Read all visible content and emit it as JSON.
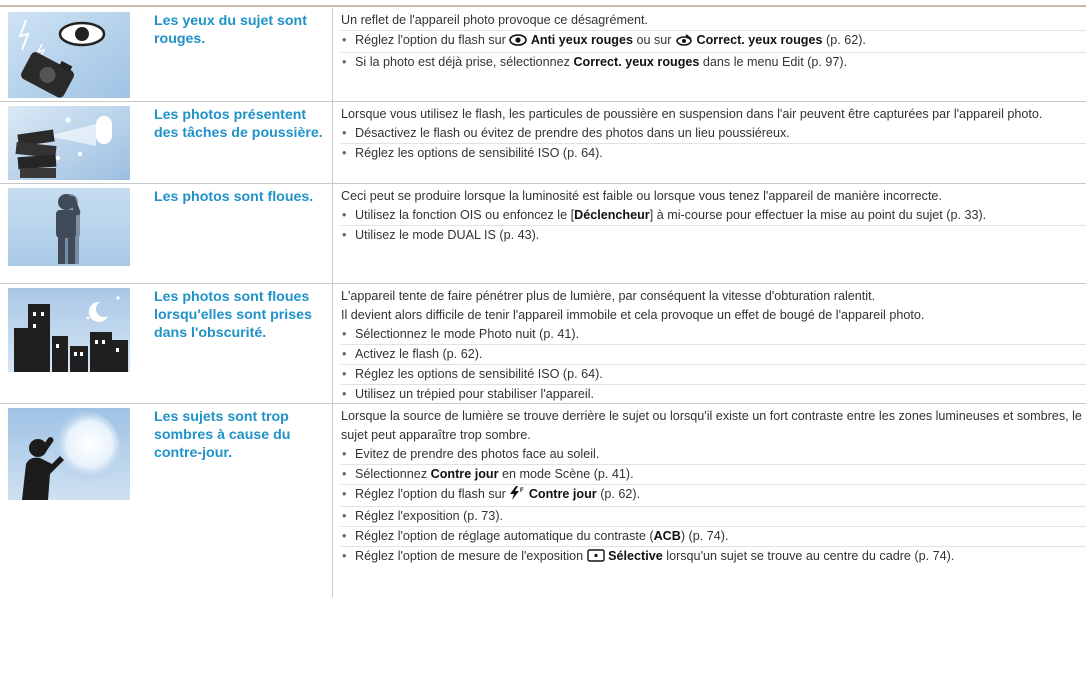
{
  "rows": [
    {
      "problem": "Les yeux du sujet sont rouges.",
      "intro": "Un reflet de l'appareil photo provoque ce désagrément.",
      "b1": {
        "pre": "Réglez l'option du flash sur",
        "k1": "Anti yeux rouges",
        "mid": "ou sur",
        "k2": "Correct. yeux rouges",
        "post": "(p. 62)."
      },
      "b2": {
        "pre": "Si la photo est déjà prise, sélectionnez",
        "k1": "Correct. yeux rouges",
        "post": "dans le menu Edit (p. 97)."
      }
    },
    {
      "problem": "Les photos présentent des tâches de poussière.",
      "intro": "Lorsque vous utilisez le flash, les particules de poussière en suspension dans l'air peuvent être capturées par l'appareil photo.",
      "b1": "Désactivez le flash ou évitez de prendre des photos dans un lieu poussiéreux.",
      "b2": "Réglez les options de sensibilité ISO (p. 64)."
    },
    {
      "problem": "Les photos sont floues.",
      "intro": "Ceci peut se produire lorsque la luminosité est faible ou lorsque vous tenez l'appareil de manière incorrecte.",
      "b1": {
        "pre": "Utilisez la fonction OIS ou enfoncez le [",
        "k1": "Déclencheur",
        "post": "] à mi-course pour effectuer la mise au point du sujet (p. 33)."
      },
      "b2": "Utilisez le mode DUAL IS (p. 43)."
    },
    {
      "problem": "Les photos sont floues lorsqu'elles sont prises dans l'obscurité.",
      "intro1": "L'appareil tente de faire pénétrer plus de lumière, par conséquent la vitesse d'obturation ralentit.",
      "intro2": "Il devient alors difficile de tenir l'appareil immobile et cela provoque un effet de bougé de l'appareil photo.",
      "b1": "Sélectionnez le mode Photo nuit (p. 41).",
      "b2": "Activez le flash (p. 62).",
      "b3": "Réglez les options de sensibilité ISO (p. 64).",
      "b4": "Utilisez un trépied pour stabiliser l'appareil."
    },
    {
      "problem": "Les sujets sont trop sombres à cause du contre-jour.",
      "intro": "Lorsque la source de lumière se trouve derrière le sujet ou lorsqu'il existe un fort contraste entre les zones lumineuses et sombres, le sujet peut apparaître trop sombre.",
      "b1": "Evitez de prendre des photos face au soleil.",
      "b2": {
        "pre": "Sélectionnez",
        "k1": "Contre jour",
        "post": "en mode Scène (p. 41)."
      },
      "b3": {
        "pre": "Réglez l'option du flash sur",
        "k1": "Contre jour",
        "post": "(p. 62)."
      },
      "b4": "Réglez l'exposition (p. 73).",
      "b5": {
        "pre": "Réglez l'option de réglage automatique du contraste (",
        "k1": "ACB",
        "post": ") (p. 74)."
      },
      "b6": {
        "pre": "Réglez l'option de mesure de l'exposition",
        "k1": "Sélective",
        "post": "lorsqu'un sujet se trouve au centre du cadre (p. 74)."
      }
    }
  ]
}
